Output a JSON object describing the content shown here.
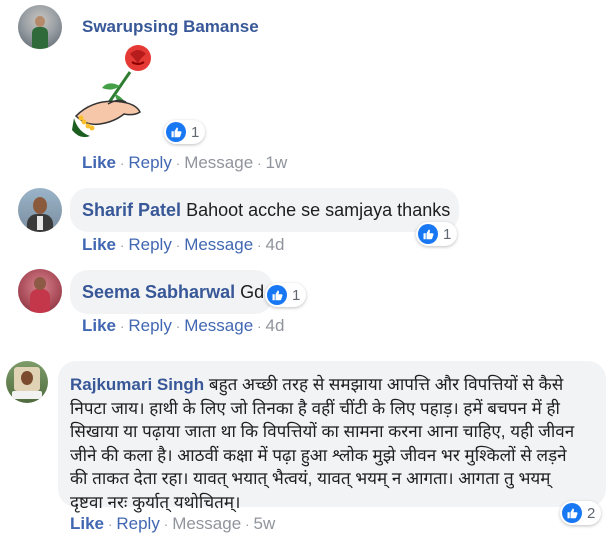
{
  "comments": [
    {
      "author": "Swarupsing Bamanse",
      "text": "",
      "sticker": "hand-holding-rose-sticker",
      "reaction_count": "1",
      "actions": {
        "like": "Like",
        "reply": "Reply",
        "message": "Message",
        "time": "1w"
      }
    },
    {
      "author": "Sharif Patel",
      "text": "Bahoot acche se samjaya thanks",
      "reaction_count": "1",
      "actions": {
        "like": "Like",
        "reply": "Reply",
        "message": "Message",
        "time": "4d"
      }
    },
    {
      "author": "Seema Sabharwal",
      "text": "Gd",
      "reaction_count": "1",
      "actions": {
        "like": "Like",
        "reply": "Reply",
        "message": "Message",
        "time": "4d"
      }
    },
    {
      "author": "Rajkumari Singh",
      "text_lines": [
        "बहुत अच्छी तरह से समझाया आपत्ति और विपत्तियों से कैसे",
        "निपटा जाय। हाथी के लिए जो तिनका है वहीं चींटी के लिए पहाड़। हमें बचपन में ही",
        "सिखाया या पढ़ाया जाता था कि विपत्तियों का सामना करना आना चाहिए, यही जीवन",
        "जीने की कला है। आठवीं कक्षा में पढ़ा हुआ श्लोक मुझे जीवन भर मुश्किलों से लड़ने",
        "की ताकत देता रहा। यावत् भयात् भैत्वयं, यावत् भयम् न आगता। आगता तु भयम्",
        "दृष्टवा नरः कुर्यात् यथोचितम्।"
      ],
      "reaction_count": "2",
      "actions": {
        "like": "Like",
        "reply": "Reply",
        "message": "Message",
        "time": "5w"
      }
    }
  ],
  "colors": {
    "name": "#385898",
    "link": "#4267b2",
    "bubble": "#f2f3f5",
    "meta": "#90949c",
    "like": "#1877f2"
  }
}
